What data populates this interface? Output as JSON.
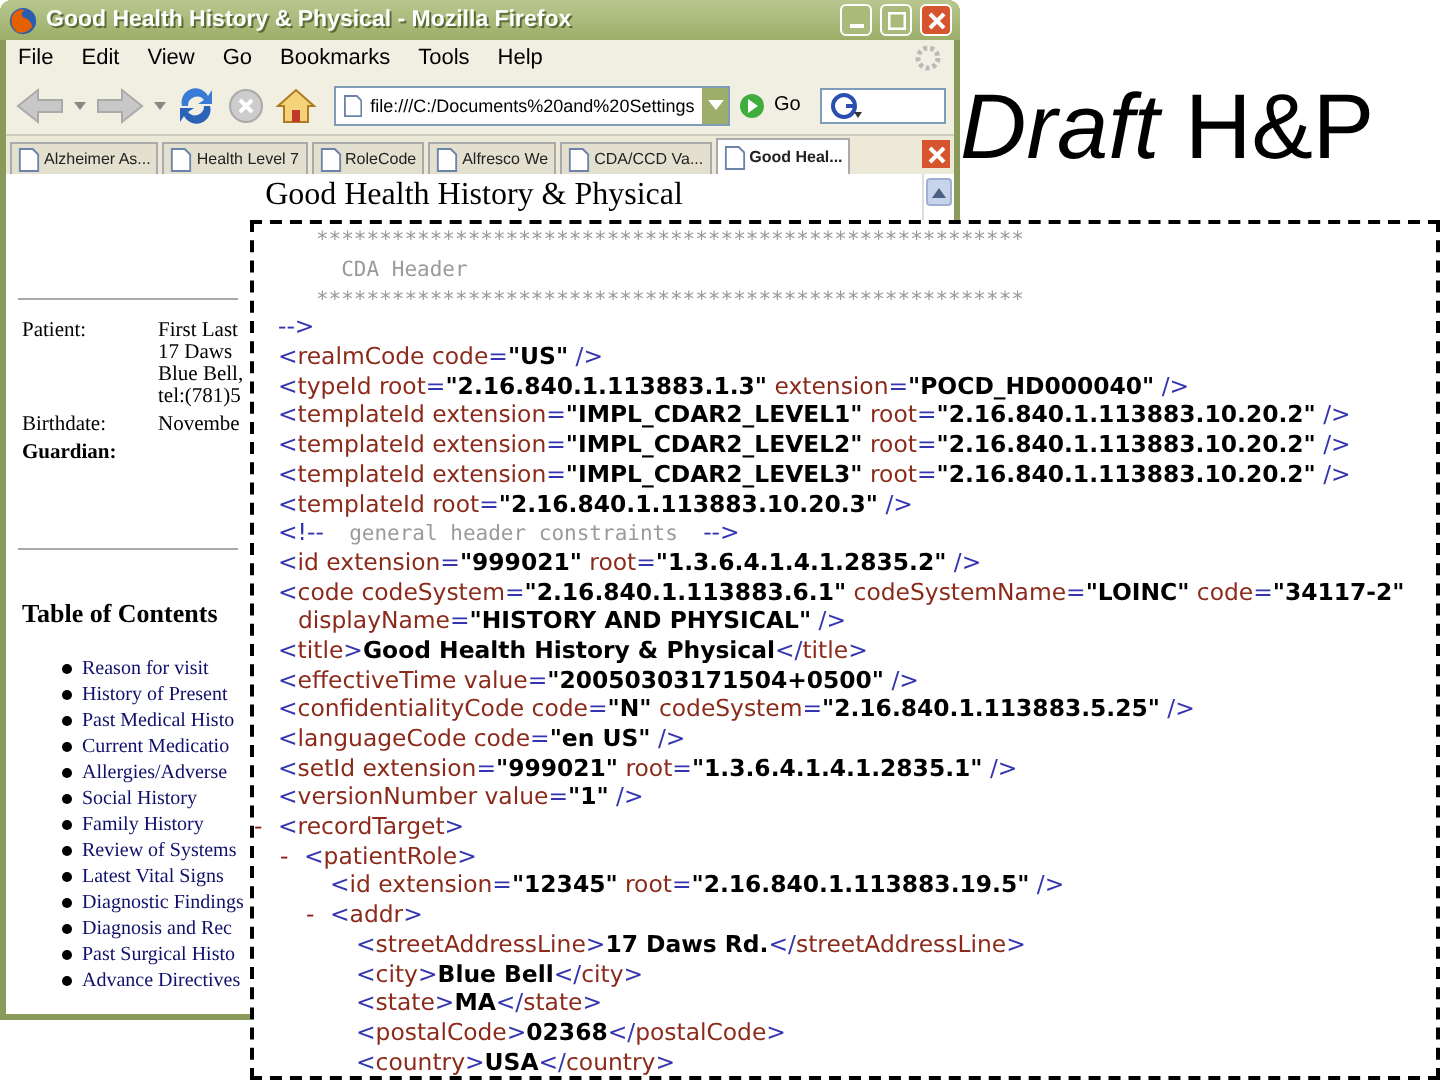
{
  "slide": {
    "title": "*Draft* H&P"
  },
  "window": {
    "title": "Good Health History & Physical - Mozilla Firefox",
    "menu": [
      "File",
      "Edit",
      "View",
      "Go",
      "Bookmarks",
      "Tools",
      "Help"
    ],
    "address": "file:///C:/Documents%20and%20Settings",
    "go": "Go",
    "tabs": [
      {
        "label": "Alzheimer As...",
        "selected": false
      },
      {
        "label": "Health Level 7",
        "selected": false
      },
      {
        "label": "RoleCode",
        "selected": false
      },
      {
        "label": "Alfresco We",
        "selected": false
      },
      {
        "label": "CDA/CCD Va...",
        "selected": false
      },
      {
        "label": "Good Heal...",
        "selected": true
      }
    ],
    "page": {
      "heading": "Good Health History & Physical",
      "demographics": [
        {
          "label": "Patient:",
          "values": [
            "First Last",
            "17 Daws",
            "Blue Bell,",
            "tel:(781)5"
          ]
        },
        {
          "label": "Birthdate:",
          "values": [
            "Novembe"
          ]
        },
        {
          "label": "Guardian:"
        }
      ],
      "toc_heading": "Table of Contents",
      "toc": [
        "Reason for visit",
        "History of Present",
        "Past Medical Histo",
        "Current Medicatio",
        "Allergies/Adverse",
        "Social History",
        "Family History",
        "Review of Systems",
        "Latest Vital Signs",
        "Diagnostic Findings",
        "Diagnosis and Rec",
        "Past Surgical Histo",
        "Advance Directives"
      ]
    }
  },
  "xml": [
    {
      "parts": [
        {
          "kind": "comment",
          "text": "   ********************************************************"
        }
      ]
    },
    {
      "parts": [
        {
          "kind": "comment",
          "text": "     CDA Header"
        }
      ]
    },
    {
      "parts": [
        {
          "kind": "comment",
          "text": "   ********************************************************"
        }
      ]
    },
    {
      "parts": [
        {
          "kind": "punct",
          "text": "-->"
        }
      ]
    },
    {
      "parts": [
        {
          "kind": "punct",
          "text": "<"
        },
        {
          "kind": "name",
          "text": "realmCode code"
        },
        {
          "kind": "punct",
          "text": "="
        },
        {
          "kind": "value",
          "text": "\"US\""
        },
        {
          "kind": "punct",
          "text": " />"
        }
      ]
    },
    {
      "parts": [
        {
          "kind": "punct",
          "text": "<"
        },
        {
          "kind": "name",
          "text": "typeId root"
        },
        {
          "kind": "punct",
          "text": "="
        },
        {
          "kind": "value",
          "text": "\"2.16.840.1.113883.1.3\""
        },
        {
          "kind": "name",
          "text": " extension"
        },
        {
          "kind": "punct",
          "text": "="
        },
        {
          "kind": "value",
          "text": "\"POCD_HD000040\""
        },
        {
          "kind": "punct",
          "text": " />"
        }
      ]
    },
    {
      "parts": [
        {
          "kind": "punct",
          "text": "<"
        },
        {
          "kind": "name",
          "text": "templateId extension"
        },
        {
          "kind": "punct",
          "text": "="
        },
        {
          "kind": "value",
          "text": "\"IMPL_CDAR2_LEVEL1\""
        },
        {
          "kind": "name",
          "text": " root"
        },
        {
          "kind": "punct",
          "text": "="
        },
        {
          "kind": "value",
          "text": "\"2.16.840.1.113883.10.20.2\""
        },
        {
          "kind": "punct",
          "text": " />"
        }
      ]
    },
    {
      "parts": [
        {
          "kind": "punct",
          "text": "<"
        },
        {
          "kind": "name",
          "text": "templateId extension"
        },
        {
          "kind": "punct",
          "text": "="
        },
        {
          "kind": "value",
          "text": "\"IMPL_CDAR2_LEVEL2\""
        },
        {
          "kind": "name",
          "text": " root"
        },
        {
          "kind": "punct",
          "text": "="
        },
        {
          "kind": "value",
          "text": "\"2.16.840.1.113883.10.20.2\""
        },
        {
          "kind": "punct",
          "text": " />"
        }
      ]
    },
    {
      "parts": [
        {
          "kind": "punct",
          "text": "<"
        },
        {
          "kind": "name",
          "text": "templateId extension"
        },
        {
          "kind": "punct",
          "text": "="
        },
        {
          "kind": "value",
          "text": "\"IMPL_CDAR2_LEVEL3\""
        },
        {
          "kind": "name",
          "text": " root"
        },
        {
          "kind": "punct",
          "text": "="
        },
        {
          "kind": "value",
          "text": "\"2.16.840.1.113883.10.20.2\""
        },
        {
          "kind": "punct",
          "text": " />"
        }
      ]
    },
    {
      "parts": [
        {
          "kind": "punct",
          "text": "<"
        },
        {
          "kind": "name",
          "text": "templateId root"
        },
        {
          "kind": "punct",
          "text": "="
        },
        {
          "kind": "value",
          "text": "\"2.16.840.1.113883.10.20.3\""
        },
        {
          "kind": "punct",
          "text": " />"
        }
      ]
    },
    {
      "parts": [
        {
          "kind": "punct",
          "text": "<!--"
        },
        {
          "kind": "comment",
          "text": "  general header constraints  "
        },
        {
          "kind": "punct",
          "text": "-->"
        }
      ]
    },
    {
      "parts": [
        {
          "kind": "punct",
          "text": "<"
        },
        {
          "kind": "name",
          "text": "id extension"
        },
        {
          "kind": "punct",
          "text": "="
        },
        {
          "kind": "value",
          "text": "\"999021\""
        },
        {
          "kind": "name",
          "text": " root"
        },
        {
          "kind": "punct",
          "text": "="
        },
        {
          "kind": "value",
          "text": "\"1.3.6.4.1.4.1.2835.2\""
        },
        {
          "kind": "punct",
          "text": " />"
        }
      ]
    },
    {
      "parts": [
        {
          "kind": "punct",
          "text": "<"
        },
        {
          "kind": "name",
          "text": "code codeSystem"
        },
        {
          "kind": "punct",
          "text": "="
        },
        {
          "kind": "value",
          "text": "\"2.16.840.1.113883.6.1\""
        },
        {
          "kind": "name",
          "text": " codeSystemName"
        },
        {
          "kind": "punct",
          "text": "="
        },
        {
          "kind": "value",
          "text": "\"LOINC\""
        },
        {
          "kind": "name",
          "text": " code"
        },
        {
          "kind": "punct",
          "text": "="
        },
        {
          "kind": "value",
          "text": "\"34117-2\""
        }
      ],
      "wrap": [
        {
          "kind": "name",
          "text": "displayName"
        },
        {
          "kind": "punct",
          "text": "="
        },
        {
          "kind": "value",
          "text": "\"HISTORY AND PHYSICAL\""
        },
        {
          "kind": "punct",
          "text": " />"
        }
      ]
    },
    {
      "parts": [
        {
          "kind": "punct",
          "text": "<"
        },
        {
          "kind": "name",
          "text": "title"
        },
        {
          "kind": "punct",
          "text": ">"
        },
        {
          "kind": "value",
          "text": "Good Health History & Physical"
        },
        {
          "kind": "punct",
          "text": "</"
        },
        {
          "kind": "name",
          "text": "title"
        },
        {
          "kind": "punct",
          "text": ">"
        }
      ]
    },
    {
      "parts": [
        {
          "kind": "punct",
          "text": "<"
        },
        {
          "kind": "name",
          "text": "effectiveTime value"
        },
        {
          "kind": "punct",
          "text": "="
        },
        {
          "kind": "value",
          "text": "\"20050303171504+0500\""
        },
        {
          "kind": "punct",
          "text": " />"
        }
      ]
    },
    {
      "parts": [
        {
          "kind": "punct",
          "text": "<"
        },
        {
          "kind": "name",
          "text": "confidentialityCode code"
        },
        {
          "kind": "punct",
          "text": "="
        },
        {
          "kind": "value",
          "text": "\"N\""
        },
        {
          "kind": "name",
          "text": " codeSystem"
        },
        {
          "kind": "punct",
          "text": "="
        },
        {
          "kind": "value",
          "text": "\"2.16.840.1.113883.5.25\""
        },
        {
          "kind": "punct",
          "text": " />"
        }
      ]
    },
    {
      "parts": [
        {
          "kind": "punct",
          "text": "<"
        },
        {
          "kind": "name",
          "text": "languageCode code"
        },
        {
          "kind": "punct",
          "text": "="
        },
        {
          "kind": "value",
          "text": "\"en US\""
        },
        {
          "kind": "punct",
          "text": " />"
        }
      ]
    },
    {
      "parts": [
        {
          "kind": "punct",
          "text": "<"
        },
        {
          "kind": "name",
          "text": "setId extension"
        },
        {
          "kind": "punct",
          "text": "="
        },
        {
          "kind": "value",
          "text": "\"999021\""
        },
        {
          "kind": "name",
          "text": " root"
        },
        {
          "kind": "punct",
          "text": "="
        },
        {
          "kind": "value",
          "text": "\"1.3.6.4.1.4.1.2835.1\""
        },
        {
          "kind": "punct",
          "text": " />"
        }
      ]
    },
    {
      "parts": [
        {
          "kind": "punct",
          "text": "<"
        },
        {
          "kind": "name",
          "text": "versionNumber value"
        },
        {
          "kind": "punct",
          "text": "="
        },
        {
          "kind": "value",
          "text": "\"1\""
        },
        {
          "kind": "punct",
          "text": " />"
        }
      ]
    },
    {
      "toggle": "-",
      "parts": [
        {
          "kind": "punct",
          "text": "<"
        },
        {
          "kind": "name",
          "text": "recordTarget"
        },
        {
          "kind": "punct",
          "text": ">"
        }
      ],
      "children": [
        {
          "toggle": "-",
          "parts": [
            {
              "kind": "punct",
              "text": "<"
            },
            {
              "kind": "name",
              "text": "patientRole"
            },
            {
              "kind": "punct",
              "text": ">"
            }
          ],
          "children": [
            {
              "parts": [
                {
                  "kind": "punct",
                  "text": "<"
                },
                {
                  "kind": "name",
                  "text": "id extension"
                },
                {
                  "kind": "punct",
                  "text": "="
                },
                {
                  "kind": "value",
                  "text": "\"12345\""
                },
                {
                  "kind": "name",
                  "text": " root"
                },
                {
                  "kind": "punct",
                  "text": "="
                },
                {
                  "kind": "value",
                  "text": "\"2.16.840.1.113883.19.5\""
                },
                {
                  "kind": "punct",
                  "text": " />"
                }
              ]
            },
            {
              "toggle": "-",
              "parts": [
                {
                  "kind": "punct",
                  "text": "<"
                },
                {
                  "kind": "name",
                  "text": "addr"
                },
                {
                  "kind": "punct",
                  "text": ">"
                }
              ],
              "children": [
                {
                  "parts": [
                    {
                      "kind": "punct",
                      "text": "<"
                    },
                    {
                      "kind": "name",
                      "text": "streetAddressLine"
                    },
                    {
                      "kind": "punct",
                      "text": ">"
                    },
                    {
                      "kind": "value",
                      "text": "17 Daws Rd."
                    },
                    {
                      "kind": "punct",
                      "text": "</"
                    },
                    {
                      "kind": "name",
                      "text": "streetAddressLine"
                    },
                    {
                      "kind": "punct",
                      "text": ">"
                    }
                  ]
                },
                {
                  "parts": [
                    {
                      "kind": "punct",
                      "text": "<"
                    },
                    {
                      "kind": "name",
                      "text": "city"
                    },
                    {
                      "kind": "punct",
                      "text": ">"
                    },
                    {
                      "kind": "value",
                      "text": "Blue Bell"
                    },
                    {
                      "kind": "punct",
                      "text": "</"
                    },
                    {
                      "kind": "name",
                      "text": "city"
                    },
                    {
                      "kind": "punct",
                      "text": ">"
                    }
                  ]
                },
                {
                  "parts": [
                    {
                      "kind": "punct",
                      "text": "<"
                    },
                    {
                      "kind": "name",
                      "text": "state"
                    },
                    {
                      "kind": "punct",
                      "text": ">"
                    },
                    {
                      "kind": "value",
                      "text": "MA"
                    },
                    {
                      "kind": "punct",
                      "text": "</"
                    },
                    {
                      "kind": "name",
                      "text": "state"
                    },
                    {
                      "kind": "punct",
                      "text": ">"
                    }
                  ]
                },
                {
                  "parts": [
                    {
                      "kind": "punct",
                      "text": "<"
                    },
                    {
                      "kind": "name",
                      "text": "postalCode"
                    },
                    {
                      "kind": "punct",
                      "text": ">"
                    },
                    {
                      "kind": "value",
                      "text": "02368"
                    },
                    {
                      "kind": "punct",
                      "text": "</"
                    },
                    {
                      "kind": "name",
                      "text": "postalCode"
                    },
                    {
                      "kind": "punct",
                      "text": ">"
                    }
                  ]
                },
                {
                  "parts": [
                    {
                      "kind": "punct",
                      "text": "<"
                    },
                    {
                      "kind": "name",
                      "text": "country"
                    },
                    {
                      "kind": "punct",
                      "text": ">"
                    },
                    {
                      "kind": "value",
                      "text": "USA"
                    },
                    {
                      "kind": "punct",
                      "text": "</"
                    },
                    {
                      "kind": "name",
                      "text": "country"
                    },
                    {
                      "kind": "punct",
                      "text": ">"
                    }
                  ]
                }
              ]
            }
          ]
        }
      ]
    }
  ]
}
